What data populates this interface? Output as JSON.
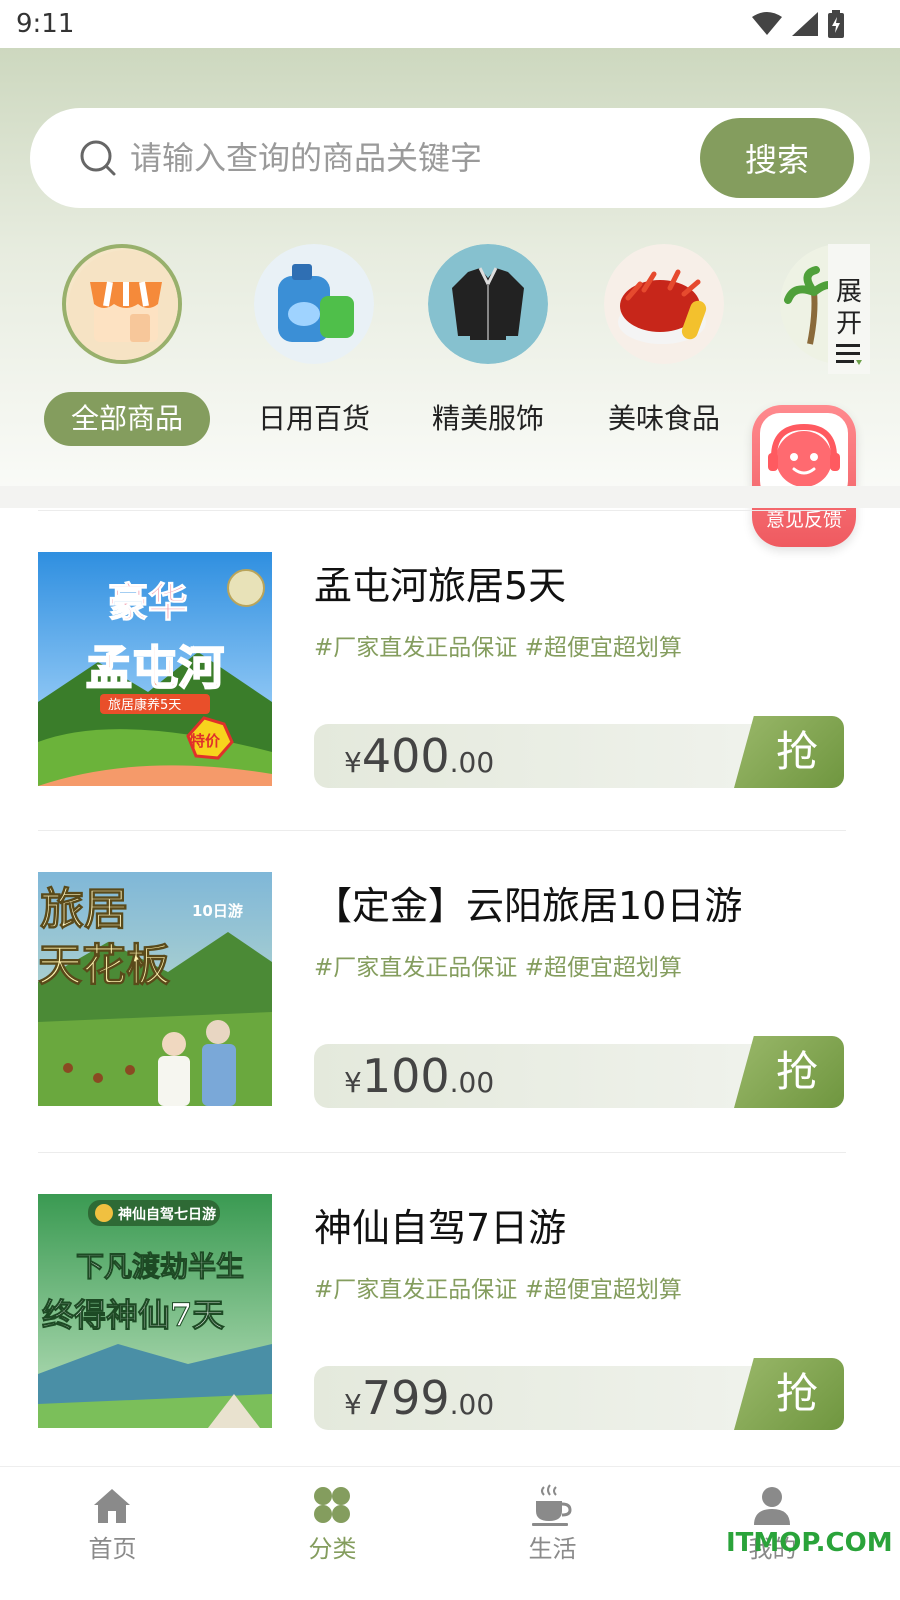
{
  "status_bar": {
    "time": "9:11"
  },
  "search": {
    "placeholder": "请输入查询的商品关键字",
    "button_label": "搜索"
  },
  "categories": [
    {
      "label": "全部商品",
      "icon": "shop-icon",
      "active": true
    },
    {
      "label": "日用百货",
      "icon": "detergent-icon",
      "active": false
    },
    {
      "label": "精美服饰",
      "icon": "jacket-icon",
      "active": false
    },
    {
      "label": "美味食品",
      "icon": "crayfish-icon",
      "active": false
    }
  ],
  "expand": {
    "label": "展开"
  },
  "feedback": {
    "label": "意见反馈"
  },
  "products": [
    {
      "title": "孟屯河旅居5天",
      "tags": "#厂家直发正品保证 #超便宜超划算",
      "currency": "¥",
      "price_int": "400",
      "price_dec": ".00",
      "grab_label": "抢",
      "image": {
        "big1": "豪华",
        "big2": "孟屯河",
        "ribbon": "旅居康养5天",
        "sticker": "特价"
      }
    },
    {
      "title": "【定金】云阳旅居10日游",
      "tags": "#厂家直发正品保证 #超便宜超划算",
      "currency": "¥",
      "price_int": "100",
      "price_dec": ".00",
      "grab_label": "抢",
      "image": {
        "big1": "旅居",
        "big2": "天花板",
        "badge": "10日游"
      }
    },
    {
      "title": "神仙自驾7日游",
      "tags": "#厂家直发正品保证 #超便宜超划算",
      "currency": "¥",
      "price_int": "799",
      "price_dec": ".00",
      "grab_label": "抢",
      "image": {
        "badge": "神仙自驾七日游",
        "big1": "下凡渡劫半生",
        "big2": "终得神仙7天"
      }
    }
  ],
  "bottom_nav": [
    {
      "label": "首页",
      "icon": "home-icon",
      "active": false
    },
    {
      "label": "分类",
      "icon": "clover-icon",
      "active": true
    },
    {
      "label": "生活",
      "icon": "coffee-icon",
      "active": false
    },
    {
      "label": "我的",
      "icon": "person-icon",
      "active": false
    }
  ],
  "watermark": "ITMOP.COM",
  "colors": {
    "accent": "#849d5e",
    "feedback": "#ef5a60"
  }
}
